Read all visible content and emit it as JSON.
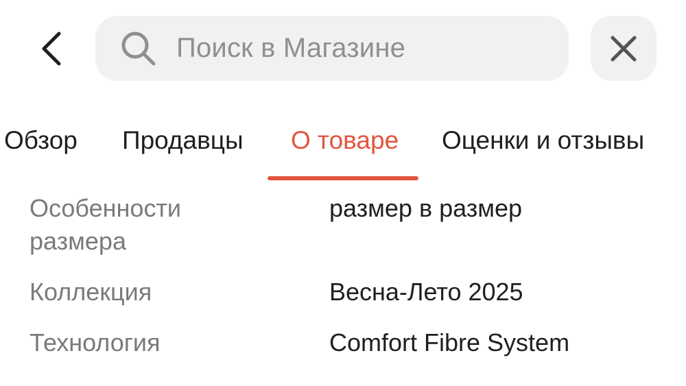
{
  "header": {
    "back_icon": "chevron-left-icon",
    "search": {
      "icon": "search-icon",
      "placeholder": "Поиск в Магазине"
    },
    "close_icon": "close-icon"
  },
  "tabs": [
    {
      "label": "Обзор",
      "active": false
    },
    {
      "label": "Продавцы",
      "active": false
    },
    {
      "label": "О товаре",
      "active": true
    },
    {
      "label": "Оценки и отзывы",
      "active": false
    }
  ],
  "attributes": [
    {
      "key": "Особенности размера",
      "value": "размер в размер"
    },
    {
      "key": "Коллекция",
      "value": "Весна-Лето 2025"
    },
    {
      "key": "Технология",
      "value": "Comfort Fibre System"
    }
  ],
  "colors": {
    "accent": "#e2553f",
    "search_bg": "#f1f1f1",
    "key_text": "#7a7a7a",
    "value_text": "#1f1f1f"
  }
}
